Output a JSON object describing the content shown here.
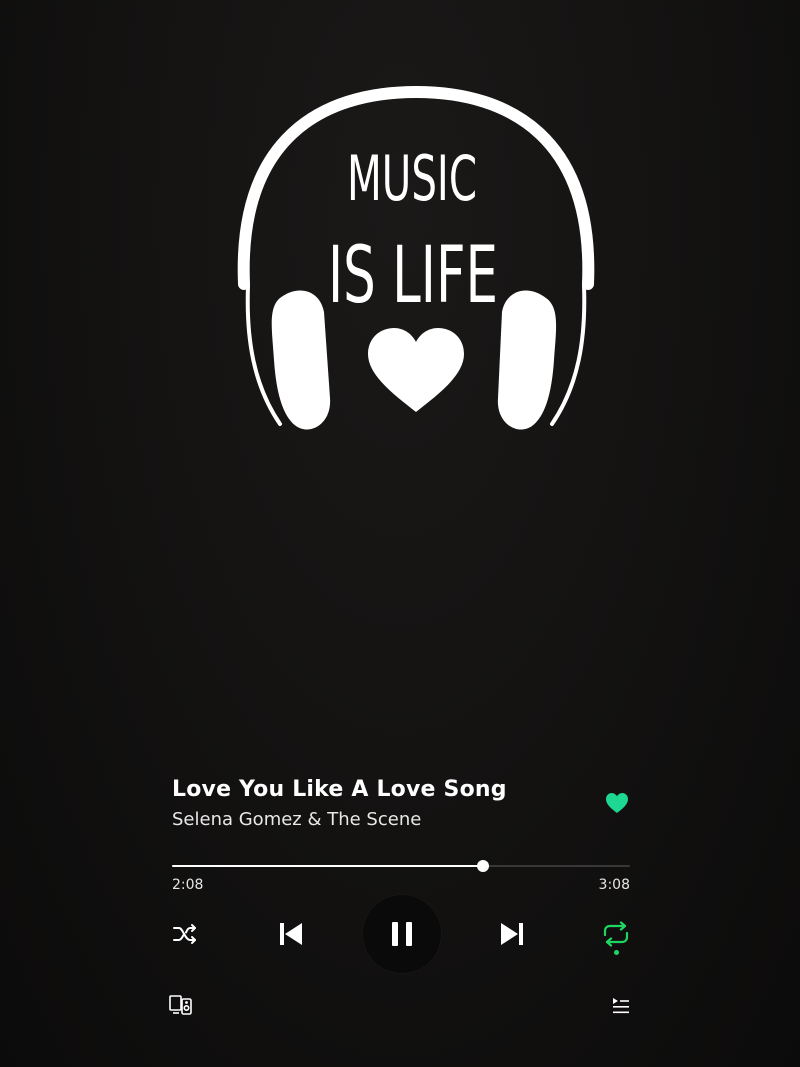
{
  "artwork": {
    "line1": "MUSIC",
    "line2": "IS LIFE",
    "heart_icon": "heart-icon",
    "headphones_icon": "headphones-icon"
  },
  "now_playing": {
    "title": "Love You Like A Love Song",
    "artist": "Selena Gomez & The Scene",
    "liked": true
  },
  "progress": {
    "elapsed": "2:08",
    "total": "3:08",
    "fraction": 0.68
  },
  "controls": {
    "shuffle_icon": "shuffle-icon",
    "previous_icon": "skip-previous-icon",
    "play_state": "playing",
    "pause_icon": "pause-icon",
    "next_icon": "skip-next-icon",
    "repeat_icon": "repeat-icon",
    "repeat_active": true,
    "devices_icon": "devices-icon",
    "queue_icon": "queue-icon"
  },
  "colors": {
    "accent": "#1ed760",
    "like": "#1ed891",
    "background": "#141312",
    "foreground": "#ffffff"
  }
}
